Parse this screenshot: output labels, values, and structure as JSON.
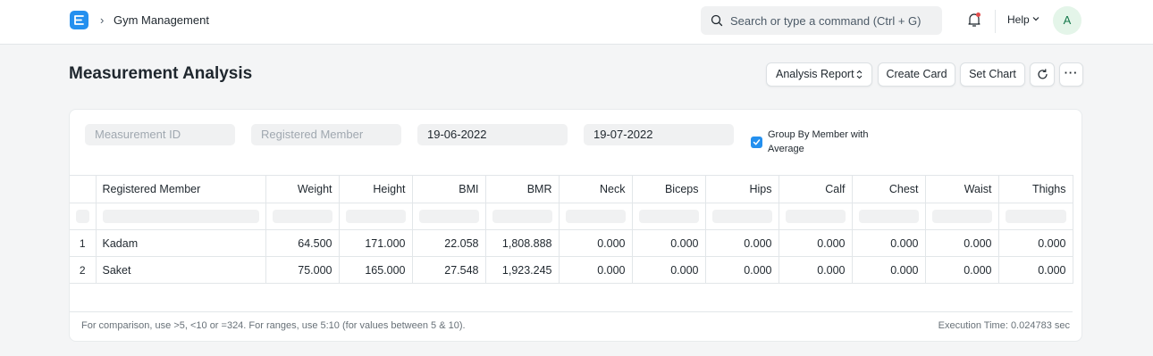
{
  "navbar": {
    "breadcrumb_chevron": "›",
    "breadcrumb": "Gym Management",
    "search_placeholder": "Search or type a command (Ctrl + G)",
    "help_label": "Help",
    "avatar_initial": "A"
  },
  "page": {
    "title": "Measurement Analysis",
    "buttons": {
      "analysis_report": "Analysis Report",
      "create_card": "Create Card",
      "set_chart": "Set Chart",
      "more": "···"
    }
  },
  "filters": {
    "measurement_id_placeholder": "Measurement ID",
    "registered_member_placeholder": "Registered Member",
    "from_date": "19-06-2022",
    "to_date": "19-07-2022",
    "group_by_label": "Group By Member with Average",
    "group_by_checked": true
  },
  "table": {
    "columns": [
      "Registered Member",
      "Weight",
      "Height",
      "BMI",
      "BMR",
      "Neck",
      "Biceps",
      "Hips",
      "Calf",
      "Chest",
      "Waist",
      "Thighs"
    ],
    "rows": [
      {
        "index": "1",
        "cells": [
          "Kadam",
          "64.500",
          "171.000",
          "22.058",
          "1,808.888",
          "0.000",
          "0.000",
          "0.000",
          "0.000",
          "0.000",
          "0.000",
          "0.000"
        ]
      },
      {
        "index": "2",
        "cells": [
          "Saket",
          "75.000",
          "165.000",
          "27.548",
          "1,923.245",
          "0.000",
          "0.000",
          "0.000",
          "0.000",
          "0.000",
          "0.000",
          "0.000"
        ]
      }
    ]
  },
  "footer": {
    "hint": "For comparison, use >5, <10 or =324. For ranges, use 5:10 (for values between 5 & 10).",
    "execution_time": "Execution Time: 0.024783 sec"
  },
  "colors": {
    "accent": "#2490ef",
    "avatar_bg": "#e4f5e9",
    "avatar_text": "#16794c",
    "notification_dot": "#e24c4c"
  },
  "icons": [
    "app-logo-icon",
    "chevron-right-icon",
    "search-icon",
    "bell-icon",
    "chevron-down-icon",
    "sort-icon",
    "refresh-icon",
    "more-icon",
    "checkbox-check-icon"
  ]
}
